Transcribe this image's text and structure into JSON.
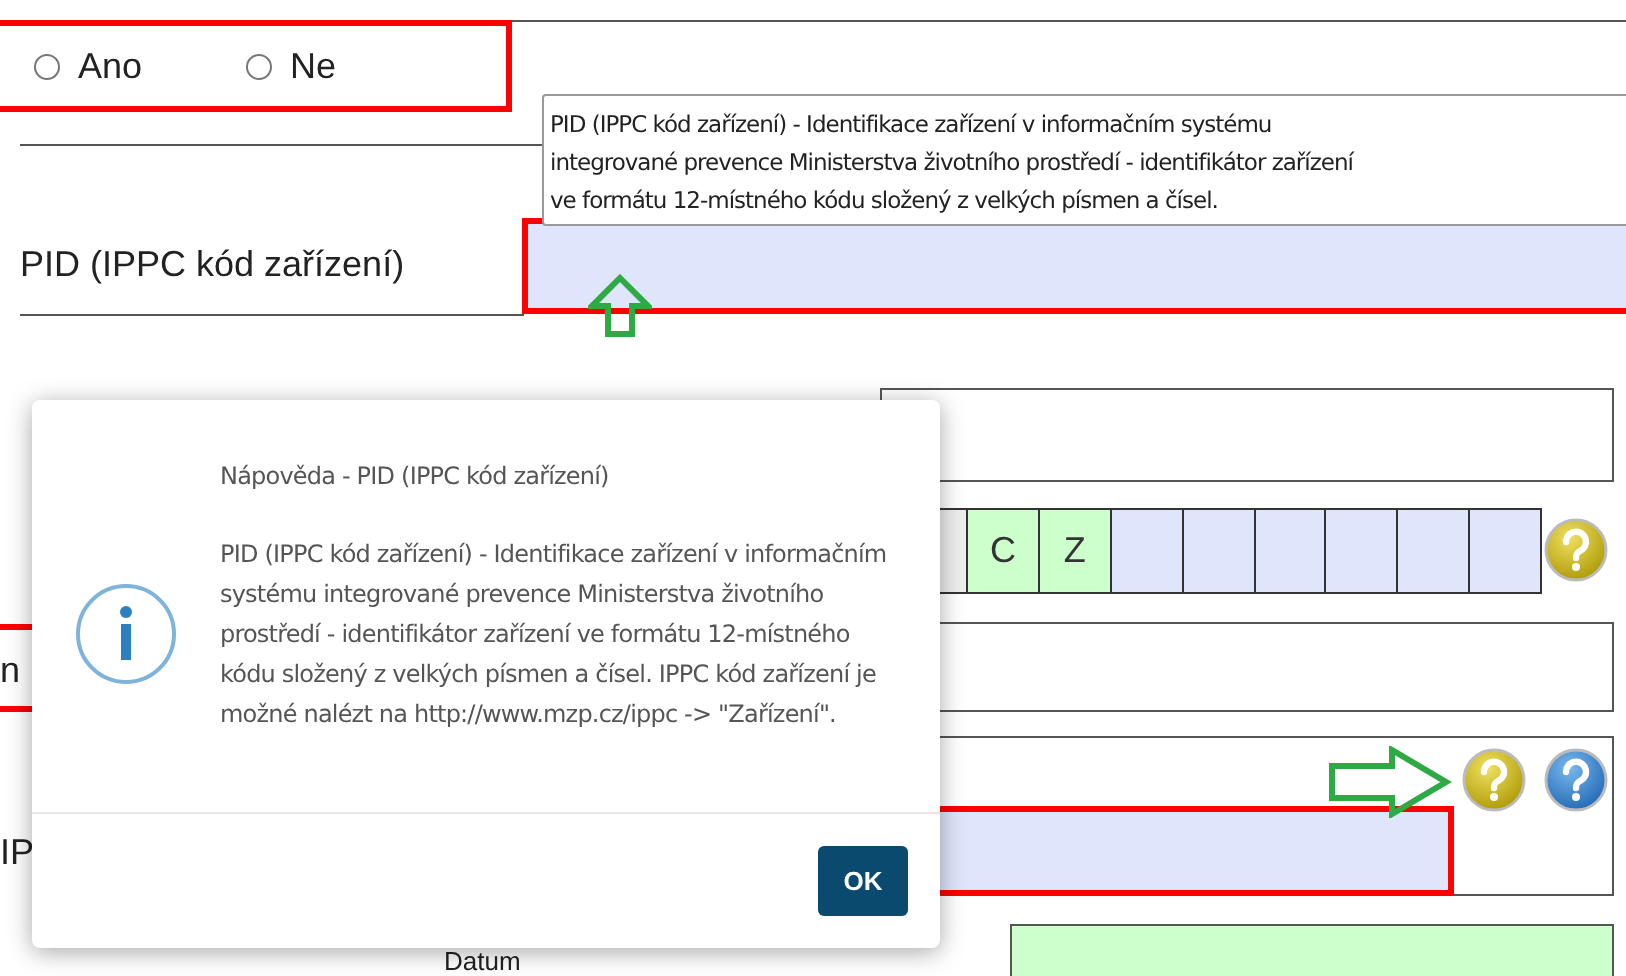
{
  "radio_group": {
    "options": [
      {
        "label": "Ano",
        "selected": false
      },
      {
        "label": "Ne",
        "selected": false
      }
    ]
  },
  "pid_field": {
    "label": "PID (IPPC kód zařízení)",
    "tooltip_lines": [
      "PID (IPPC kód zařízení) - Identifikace zařízení v informačním systému",
      "integrované prevence Ministerstva životního prostředí - identifikátor zařízení",
      "ve formátu 12-místného kódu složený z velkých písmen a čísel."
    ]
  },
  "code_field": {
    "prefix": [
      "C",
      "Z"
    ]
  },
  "partial_labels": [
    "n",
    "IP",
    "Datum"
  ],
  "dialog": {
    "title": "Nápověda - PID (IPPC kód zařízení)",
    "message": "PID (IPPC kód zařízení) - Identifikace zařízení v informačním systému integrované prevence Ministerstva životního prostředí - identifikátor zařízení ve formátu 12-místného kódu složený z velkých písmen a čísel. IPPC kód zařízení je možné nalézt na http://www.mzp.cz/ippc -> \"Zařízení\".",
    "button": "OK"
  }
}
